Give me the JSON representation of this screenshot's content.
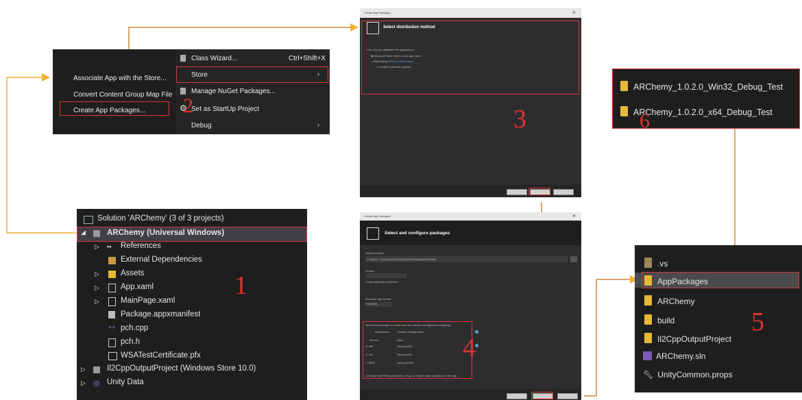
{
  "menu": {
    "left_items": [
      "Associate App with the Store...",
      "Convert Content Group Map File",
      "Create App Packages..."
    ],
    "right_items": [
      {
        "label": "Class Wizard...",
        "shortcut": "Ctrl+Shift+X"
      },
      {
        "label": "Store",
        "shortcut": ""
      },
      {
        "label": "Manage NuGet Packages...",
        "shortcut": ""
      },
      {
        "label": "Set as StartUp Project",
        "shortcut": ""
      },
      {
        "label": "Debug",
        "shortcut": ""
      }
    ],
    "step": "2"
  },
  "solution": {
    "title": "Solution 'ARChemy' (3 of 3 projects)",
    "project": "ARChemy (Universal Windows)",
    "items": [
      "References",
      "External Dependencies",
      "Assets",
      "App.xaml",
      "MainPage.xaml",
      "Package.appxmanifest",
      "pch.cpp",
      "pch.h",
      "WSATestCertificate.pfx"
    ],
    "other_projects": [
      "Il2CppOutputProject (Windows Store 10.0)",
      "Unity Data"
    ],
    "step": "1"
  },
  "dialog1": {
    "window_title": "Create App Packages",
    "heading": "Select distribution method",
    "question": "How will you distribute this application?",
    "option1": "Microsoft Store under a new app name",
    "option2": "Sideloading",
    "option2_link": "What is sideloading?",
    "checkbox": "Enable automatic updates",
    "buttons": [
      "Previous",
      "Next",
      "Cancel"
    ],
    "step": "3"
  },
  "dialog2": {
    "window_title": "Create App Packages",
    "heading": "Select and configure packages",
    "output_label": "Output location",
    "output_value": "C:\\Users\\...\\Desktop\\ARChemy\\AppPackages\\ARChemy\\",
    "version_label": "Version",
    "auto_increment": "Automatically increment",
    "generate_label": "Generate app bundle",
    "generate_value": "If needed",
    "select_label": "Select the packages to create and the solution configuration mappings",
    "col_arch": "Architecture",
    "col_config": "Solution Configuration",
    "table_header": [
      "Neutral",
      "None"
    ],
    "arch_rows": [
      {
        "arch": "x86",
        "config": "Debug (x86)"
      },
      {
        "arch": "x64",
        "config": "Debug (x64)"
      },
      {
        "arch": "ARM",
        "config": "Debug (ARM)"
      }
    ],
    "symbols": "Include full PDB symbol files, if any, to enable crash analytics for the app.",
    "buttons": [
      "Previous",
      "Create",
      "Cancel"
    ],
    "step": "4"
  },
  "folder_list": {
    "items": [
      ".vs",
      "AppPackages",
      "ARChemy",
      "build",
      "Il2CppOutputProject",
      "ARChemy.sln",
      "UnityCommon.props"
    ],
    "step": "5"
  },
  "output_folders": {
    "items": [
      "ARChemy_1.0.2.0_Win32_Debug_Test",
      "ARChemy_1.0.2.0_x64_Debug_Test"
    ],
    "step": "6"
  },
  "colors": {
    "highlight": "#d8383a",
    "arrow": "#e0a030",
    "folder": "#e8b935",
    "panel": "#1e1e1e"
  }
}
